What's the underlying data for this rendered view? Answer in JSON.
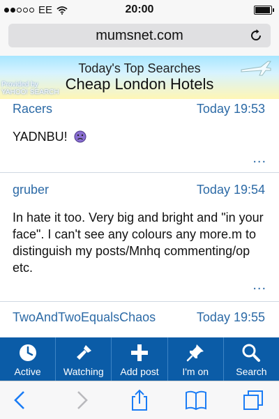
{
  "status_bar": {
    "carrier": "EE",
    "time": "20:00"
  },
  "url_bar": {
    "url": "mumsnet.com"
  },
  "ad": {
    "title": "Today's Top Searches",
    "subtitle": "Cheap London Hotels",
    "provider_line1": "Provided by",
    "provider_line2": "YAHOO! SEARCH"
  },
  "posts": [
    {
      "author": "Racers",
      "time": "Today 19:53",
      "body": "YADNBU!",
      "more": "..."
    },
    {
      "author": "gruber",
      "time": "Today 19:54",
      "body": "In hate it too. Very big and bright and \"in your face\". I can't see any colours any more.m to distinguish my posts/Mnhq commenting/op etc.",
      "more": "..."
    },
    {
      "author": "TwoAndTwoEqualsChaos",
      "time": "Today 19:55"
    }
  ],
  "toolbar": {
    "items": [
      {
        "label": "Active",
        "icon": "clock-icon"
      },
      {
        "label": "Watching",
        "icon": "flashlight-icon"
      },
      {
        "label": "Add post",
        "icon": "plus-icon"
      },
      {
        "label": "I'm on",
        "icon": "pin-icon"
      },
      {
        "label": "Search",
        "icon": "search-icon"
      }
    ]
  },
  "colors": {
    "toolbar_bg": "#0b5ca7",
    "link_blue": "#2c6aa6"
  }
}
